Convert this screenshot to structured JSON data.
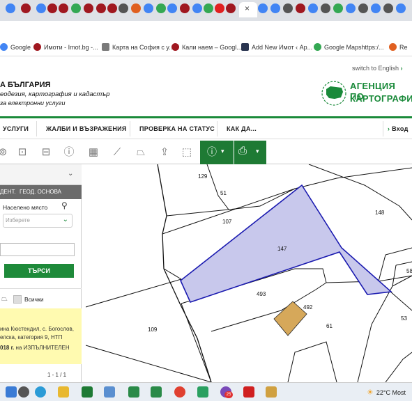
{
  "browser": {
    "close_tab": "×",
    "bookmarks": [
      {
        "label": "Google",
        "color": "#4285f4"
      },
      {
        "label": "Имоти - Imot.bg -...",
        "color": "#a01820"
      },
      {
        "label": "Карта на София с у...",
        "color": "#7a7a7a"
      },
      {
        "label": "Кали наем – Googl...",
        "color": "#a01820"
      },
      {
        "label": "Add New Имот ‹ Ap...",
        "color": "#2a3550"
      },
      {
        "label": "Google Mapshttps:/...",
        "color": "#34a853"
      },
      {
        "label": "Re",
        "color": "#e06020"
      }
    ]
  },
  "header": {
    "title": "А БЪЛГАРИЯ",
    "subtitle1": "еодезия, картография и кадастър",
    "subtitle2": "за електронни услуги",
    "switch_lang": "switch to English",
    "switch_lang_icon": "chevron-right-icon",
    "logo_line1": "АГЕНЦИЯ ПО",
    "logo_line2": "КАРТОГРАФИ"
  },
  "nav": {
    "items": [
      "УСЛУГИ",
      "ЖАЛБИ И ВЪЗРАЖЕНИЯ",
      "ПРОВЕРКА НА СТАТУС",
      "КАК ДА..."
    ],
    "login": "Вход",
    "login_icon": "login-icon"
  },
  "toolbar": {
    "tools": [
      "target-icon",
      "add-frame-icon",
      "remove-frame-icon",
      "info-icon",
      "grid-select-icon",
      "ruler-icon",
      "polygon-measure-icon",
      "upload-icon",
      "dashed-select-icon"
    ],
    "layers_icon": "layers-info-icon",
    "print_icon": "printer-icon",
    "accent": "#1e7a34"
  },
  "sidebar": {
    "tab1": "ДЕНТ.",
    "tab2": "ГЕОД. ОСНОВА",
    "settlement_label": "Населено място",
    "settlement_placeholder": "Изберете",
    "search_button": "ТЪРСИ",
    "all_label": "Всички",
    "result_line1": "ина Кюстендил, с. Богослов,",
    "result_line2": "елска, категория 9, НТП",
    "result_line3_bold": "018 г.",
    "result_line3_rest": " на ИЗПЪЛНИТЕЛЕН",
    "pager": "1 - 1 / 1"
  },
  "map": {
    "parcels": [
      "129",
      "51",
      "107",
      "147",
      "148",
      "493",
      "492",
      "109",
      "61",
      "53",
      "58"
    ],
    "selected_parcel": "147",
    "highlight_color": "#c8c8ec",
    "outline_color": "#1a1ab0",
    "building_color": "#d6a85a"
  },
  "taskbar": {
    "weather": "22°C  Most",
    "notification_count": "25"
  }
}
